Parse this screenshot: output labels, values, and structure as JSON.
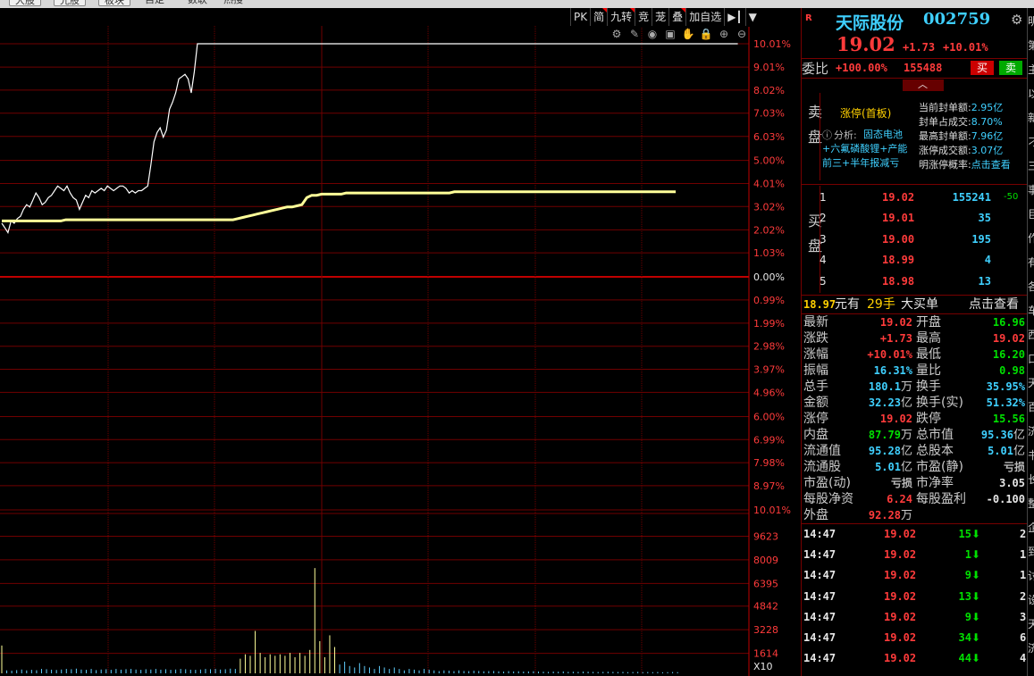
{
  "topbar": {
    "tabs": [
      "大股",
      "光股",
      "板块",
      "自定",
      "数联",
      "热搜"
    ]
  },
  "toolbar": {
    "buttons": [
      {
        "label": "PK",
        "flag": false
      },
      {
        "label": "简",
        "flag": true
      },
      {
        "label": "九转",
        "flag": true
      },
      {
        "label": "竞",
        "flag": false
      },
      {
        "label": "茏",
        "flag": false
      },
      {
        "label": "叠",
        "flag": true
      },
      {
        "label": "加自选",
        "flag": false
      },
      {
        "label": "▶┃",
        "flag": false
      },
      {
        "label": "▼",
        "flag": false
      }
    ],
    "icons": [
      "gear-icon",
      "pen-icon",
      "eye-icon",
      "save-icon",
      "hand-icon",
      "lock-icon",
      "zoom-in-icon",
      "zoom-out-icon"
    ]
  },
  "chart_data": {
    "type": "line",
    "price_axis_labels": [
      "10.01%",
      "9.01%",
      "8.02%",
      "7.03%",
      "6.03%",
      "5.00%",
      "4.01%",
      "3.02%",
      "2.02%",
      "1.03%",
      "0.00%",
      "0.99%",
      "1.99%",
      "2.98%",
      "3.97%",
      "4.96%",
      "6.00%",
      "6.99%",
      "7.98%",
      "8.97%",
      "10.01%"
    ],
    "price_axis_values": [
      10.01,
      9.01,
      8.02,
      7.03,
      6.03,
      5.0,
      4.01,
      3.02,
      2.02,
      1.03,
      0.0,
      -0.99,
      -1.99,
      -2.98,
      -3.97,
      -4.96,
      -6.0,
      -6.99,
      -7.98,
      -8.97,
      -10.01
    ],
    "volume_axis_labels": [
      "9623",
      "8009",
      "6395",
      "4842",
      "3228",
      "1614",
      "X10"
    ],
    "volume_axis_values": [
      9623,
      8009,
      6395,
      4842,
      3228,
      1614
    ],
    "ylim": [
      -10.01,
      10.01
    ],
    "series": [
      {
        "color": "#ffffff",
        "values": [
          2.3,
          2.1,
          1.9,
          2.4,
          2.3,
          2.5,
          2.6,
          2.9,
          3.1,
          3.0,
          3.3,
          3.6,
          3.4,
          3.1,
          3.2,
          3.4,
          3.5,
          3.7,
          3.9,
          3.8,
          3.7,
          3.9,
          3.6,
          3.4,
          3.3,
          2.9,
          3.2,
          3.5,
          3.4,
          3.7,
          3.6,
          3.7,
          3.8,
          3.7,
          3.9,
          3.8,
          3.7,
          3.8,
          3.9,
          3.9,
          3.8,
          3.6,
          3.7,
          3.6,
          3.7,
          3.7,
          3.8,
          3.9,
          4.8,
          5.8,
          6.2,
          6.4,
          6.0,
          6.3,
          7.2,
          7.5,
          7.9,
          8.5,
          8.6,
          8.7,
          8.5,
          7.9,
          8.8,
          10.01,
          10.01,
          10.01,
          10.01,
          10.01,
          10.01,
          10.01,
          10.01,
          10.01,
          10.01,
          10.01,
          10.01,
          10.01,
          10.01,
          10.01,
          10.01,
          10.01,
          10.01,
          10.01,
          10.01,
          10.01,
          10.01,
          10.01,
          10.01,
          10.01,
          10.01,
          10.01,
          10.01,
          10.01,
          10.01,
          10.01,
          10.01,
          10.01,
          10.01,
          10.01,
          10.01,
          10.01,
          10.01,
          10.01,
          10.01,
          10.01,
          10.01,
          10.01,
          10.01,
          10.01,
          10.01,
          10.01,
          10.01,
          10.01,
          10.01,
          10.01,
          10.01,
          10.01,
          10.01,
          10.01,
          10.01,
          10.01,
          10.01,
          10.01,
          10.01,
          10.01,
          10.01,
          10.01,
          10.01,
          10.01,
          10.01,
          10.01,
          10.01,
          10.01,
          10.01,
          10.01,
          10.01,
          10.01,
          10.01,
          10.01,
          10.01,
          10.01,
          10.01,
          10.01,
          10.01,
          10.01,
          10.01,
          10.01,
          10.01,
          10.01,
          10.01,
          10.01,
          10.01,
          10.01,
          10.01,
          10.01,
          10.01,
          10.01,
          10.01,
          10.01,
          10.01,
          10.01,
          10.01,
          10.01,
          10.01,
          10.01,
          10.01,
          10.01,
          10.01,
          10.01,
          10.01,
          10.01,
          10.01,
          10.01,
          10.01,
          10.01,
          10.01,
          10.01,
          10.01,
          10.01,
          10.01,
          10.01,
          10.01,
          10.01,
          10.01,
          10.01,
          10.01,
          10.01,
          10.01,
          10.01,
          10.01,
          10.01,
          10.01,
          10.01,
          10.01,
          10.01,
          10.01,
          10.01,
          10.01,
          10.01,
          10.01,
          10.01,
          10.01,
          10.01,
          10.01,
          10.01,
          10.01,
          10.01,
          10.01,
          10.01,
          10.01,
          10.01,
          10.01,
          10.01,
          10.01,
          10.01,
          10.01,
          10.01,
          10.01,
          10.01,
          10.01,
          10.01,
          10.01,
          10.01,
          10.01,
          10.01,
          10.01,
          10.01,
          10.01,
          10.01,
          10.01,
          10.01,
          10.01,
          10.01,
          10.01,
          10.01,
          10.01,
          10.01,
          10.01,
          10.01
        ]
      },
      {
        "color": "#ffff99",
        "values": [
          2.4,
          2.4,
          2.4,
          2.4,
          2.4,
          2.4,
          2.4,
          2.4,
          2.4,
          2.4,
          2.4,
          2.4,
          2.4,
          2.45,
          2.45,
          2.45,
          2.45,
          2.45,
          2.45,
          2.45,
          2.45,
          2.45,
          2.45,
          2.45,
          2.45,
          2.45,
          2.45,
          2.45,
          2.45,
          2.45,
          2.45,
          2.45,
          2.45,
          2.45,
          2.45,
          2.45,
          2.45,
          2.45,
          2.45,
          2.45,
          2.45,
          2.45,
          2.45,
          2.45,
          2.45,
          2.45,
          2.45,
          2.45,
          2.5,
          2.55,
          2.6,
          2.65,
          2.7,
          2.75,
          2.8,
          2.85,
          2.9,
          2.95,
          3.0,
          3.0,
          3.05,
          3.1,
          3.4,
          3.5,
          3.5,
          3.55,
          3.55,
          3.55,
          3.55,
          3.55,
          3.6,
          3.6,
          3.6,
          3.6,
          3.6,
          3.6,
          3.6,
          3.6,
          3.6,
          3.6,
          3.6,
          3.6,
          3.6,
          3.6,
          3.6,
          3.6,
          3.6,
          3.6,
          3.6,
          3.6,
          3.6,
          3.6,
          3.65,
          3.65,
          3.65,
          3.65,
          3.65,
          3.65,
          3.65,
          3.65,
          3.65,
          3.65,
          3.65,
          3.65,
          3.65,
          3.65,
          3.65,
          3.65,
          3.65,
          3.65,
          3.65,
          3.65,
          3.65,
          3.65,
          3.65,
          3.65,
          3.65,
          3.65,
          3.65,
          3.65,
          3.65,
          3.65,
          3.65,
          3.65,
          3.65,
          3.65,
          3.65,
          3.65,
          3.65,
          3.65,
          3.65,
          3.65,
          3.65,
          3.65,
          3.65,
          3.65,
          3.65,
          3.65,
          3.65,
          3.65,
          3.65,
          3.65,
          3.65,
          3.65,
          3.65,
          3.65,
          3.65,
          3.65,
          3.65,
          3.65,
          3.65,
          3.65,
          3.65,
          3.65,
          3.65,
          3.65,
          3.65
        ]
      }
    ],
    "volume": [
      1900,
      200,
      180,
      220,
      260,
      200,
      240,
      210,
      300,
      280,
      250,
      230,
      260,
      300,
      280,
      320,
      260,
      240,
      300,
      220,
      260,
      280,
      240,
      300,
      250,
      280,
      300,
      260,
      240,
      280,
      260,
      300,
      250,
      280,
      240,
      260,
      300,
      280,
      250,
      240,
      260,
      300,
      280,
      300,
      260,
      280,
      320,
      300,
      1000,
      1300,
      1200,
      2900,
      1400,
      1100,
      1300,
      1200,
      1300,
      1200,
      1400,
      1100,
      1400,
      1200,
      1600,
      7200,
      2200,
      1100,
      2600,
      1800,
      600,
      800,
      500,
      400,
      700,
      500,
      400,
      300,
      500,
      400,
      300,
      400,
      300,
      200,
      300,
      250,
      200,
      300,
      250,
      200,
      150,
      200,
      180,
      150,
      200,
      160,
      150,
      180,
      160,
      140,
      150,
      160,
      140,
      120,
      150,
      130,
      140,
      120,
      130,
      140,
      120,
      110,
      100,
      120,
      110,
      130,
      100,
      110,
      100,
      120,
      110,
      100,
      90,
      100,
      110,
      100,
      90,
      100,
      80,
      90,
      100,
      80,
      90,
      80,
      90,
      70,
      80,
      90,
      80,
      70,
      80,
      70,
      80,
      90,
      70,
      80,
      70,
      80,
      70,
      60
    ]
  },
  "quote": {
    "badge": "R",
    "name": "天际股份",
    "code": "002759",
    "price": "19.02",
    "change": "+1.73",
    "pct": "+10.01%",
    "weibi_label": "委比",
    "weibi_pct": "+100.00%",
    "weibi_vol": "155488",
    "buy_btn": "买",
    "sell_btn": "卖",
    "sell_side_label": "卖盘",
    "limit_title": "涨停(首板)",
    "analysis_label": "分析:",
    "analysis_text": "固态电池+六氟磷酸锂+产能前三+半年报减亏",
    "seal_info": [
      {
        "label": "当前封单额:",
        "value": "2.95亿"
      },
      {
        "label": "封单占成交:",
        "value": "8.70%"
      },
      {
        "label": "最高封单额:",
        "value": "7.96亿"
      },
      {
        "label": "涨停成交额:",
        "value": "3.07亿"
      },
      {
        "label": "明涨停概率:",
        "value": "点击查看"
      }
    ],
    "buy_side_label": "买盘",
    "bids": [
      {
        "level": "1",
        "price": "19.02",
        "vol": "155241",
        "delta": "-50"
      },
      {
        "level": "2",
        "price": "19.01",
        "vol": "35",
        "delta": ""
      },
      {
        "level": "3",
        "price": "19.00",
        "vol": "195",
        "delta": ""
      },
      {
        "level": "4",
        "price": "18.99",
        "vol": "4",
        "delta": ""
      },
      {
        "level": "5",
        "price": "18.98",
        "vol": "13",
        "delta": ""
      }
    ],
    "big_order": {
      "price": "18.97",
      "unit1": "元有",
      "hands": "29手",
      "label": "大买单",
      "link": "点击查看"
    }
  },
  "stats": [
    {
      "l1": "最新",
      "v1": "19.02",
      "c1": "red",
      "u1": "",
      "l2": "开盘",
      "v2": "16.96",
      "c2": "green",
      "u2": ""
    },
    {
      "l1": "涨跌",
      "v1": "+1.73",
      "c1": "red",
      "u1": "",
      "l2": "最高",
      "v2": "19.02",
      "c2": "red",
      "u2": ""
    },
    {
      "l1": "涨幅",
      "v1": "+10.01%",
      "c1": "red",
      "u1": "",
      "l2": "最低",
      "v2": "16.20",
      "c2": "green",
      "u2": ""
    },
    {
      "l1": "振幅",
      "v1": "16.31%",
      "c1": "cyan",
      "u1": "",
      "l2": "量比",
      "v2": "0.98",
      "c2": "green",
      "u2": ""
    },
    {
      "l1": "总手",
      "v1": "180.1",
      "c1": "cyan",
      "u1": "万",
      "l2": "换手",
      "v2": "35.95%",
      "c2": "cyan",
      "u2": ""
    },
    {
      "l1": "金额",
      "v1": "32.23",
      "c1": "cyan",
      "u1": "亿",
      "l2": "换手(实)",
      "v2": "51.32%",
      "c2": "cyan",
      "u2": ""
    },
    {
      "l1": "涨停",
      "v1": "19.02",
      "c1": "red",
      "u1": "",
      "l2": "跌停",
      "v2": "15.56",
      "c2": "green",
      "u2": ""
    },
    {
      "l1": "内盘",
      "v1": "87.79",
      "c1": "green",
      "u1": "万",
      "l2": "总市值",
      "v2": "95.36",
      "c2": "cyan",
      "u2": "亿"
    },
    {
      "l1": "流通值",
      "v1": "95.28",
      "c1": "cyan",
      "u1": "亿",
      "l2": "总股本",
      "v2": "5.01",
      "c2": "cyan",
      "u2": "亿"
    },
    {
      "l1": "流通股",
      "v1": "5.01",
      "c1": "cyan",
      "u1": "亿",
      "l2": "市盈(静)",
      "v2": "亏损",
      "c2": "gray",
      "u2": ""
    },
    {
      "l1": "市盈(动)",
      "v1": "亏损",
      "c1": "gray",
      "u1": "",
      "l2": "市净率",
      "v2": "3.05",
      "c2": "white",
      "u2": ""
    },
    {
      "l1": "每股净资",
      "v1": "6.24",
      "c1": "red",
      "u1": "",
      "l2": "每股盈利",
      "v2": "-0.100",
      "c2": "white",
      "u2": ""
    },
    {
      "l1": "外盘",
      "v1": "92.28",
      "c1": "red",
      "u1": "万",
      "l2": "",
      "v2": "",
      "c2": "white",
      "u2": ""
    }
  ],
  "ticks": [
    {
      "time": "14:47",
      "price": "19.02",
      "vol": "15",
      "dir": "down",
      "n": "2"
    },
    {
      "time": "14:47",
      "price": "19.02",
      "vol": "1",
      "dir": "down",
      "n": "1"
    },
    {
      "time": "14:47",
      "price": "19.02",
      "vol": "9",
      "dir": "down",
      "n": "1"
    },
    {
      "time": "14:47",
      "price": "19.02",
      "vol": "13",
      "dir": "down",
      "n": "2"
    },
    {
      "time": "14:47",
      "price": "19.02",
      "vol": "9",
      "dir": "down",
      "n": "3"
    },
    {
      "time": "14:47",
      "price": "19.02",
      "vol": "34",
      "dir": "down",
      "n": "6"
    },
    {
      "time": "14:47",
      "price": "19.02",
      "vol": "44",
      "dir": "down",
      "n": "4"
    }
  ],
  "edge_chars": [
    "明",
    "第",
    "主",
    "以",
    "新",
    "刁",
    "三",
    "事",
    "巨",
    "作",
    "有",
    "各",
    "车",
    "西",
    "口",
    "天",
    "百",
    "济",
    "书",
    "长",
    "整",
    "企",
    "到",
    "讨",
    "设",
    "天",
    "济"
  ],
  "colors": {
    "up": "#ff3b3b",
    "down": "#00e000",
    "grid": "#700000",
    "avg": "#ffff99"
  }
}
